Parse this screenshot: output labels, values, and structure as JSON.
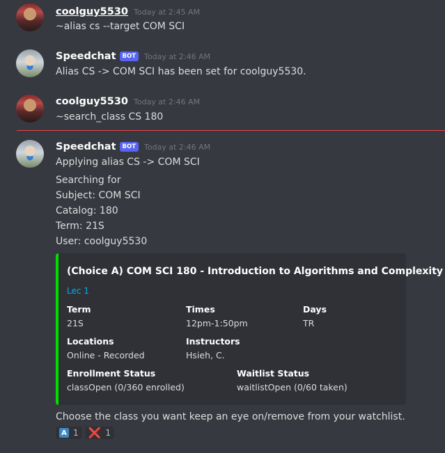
{
  "messages": [
    {
      "user": "coolguy5530",
      "time": "Today at 2:45 AM",
      "lines": [
        "~alias cs --target COM SCI"
      ]
    },
    {
      "user": "Speedchat",
      "bot": "BOT",
      "time": "Today at 2:46 AM",
      "lines": [
        "Alias CS -> COM SCI has been set for coolguy5530."
      ]
    },
    {
      "user": "coolguy5530",
      "time": "Today at 2:46 AM",
      "lines": [
        "~search_class CS 180"
      ]
    },
    {
      "user": "Speedchat",
      "bot": "BOT",
      "time": "Today at 2:46 AM",
      "lines": [
        "Applying alias CS -> COM SCI",
        "Searching for",
        "Subject: COM SCI",
        "Catalog: 180",
        "Term: 21S",
        "User: coolguy5530"
      ]
    }
  ],
  "embed": {
    "title": "(Choice A) COM SCI 180 - Introduction to Algorithms and Complexity",
    "link": "Lec 1",
    "accent": "#00e000",
    "fields": [
      {
        "name": "Term",
        "value": "21S"
      },
      {
        "name": "Times",
        "value": "12pm-1:50pm"
      },
      {
        "name": "Days",
        "value": "TR"
      },
      {
        "name": "Locations",
        "value": "Online - Recorded"
      },
      {
        "name": "Instructors",
        "value": "Hsieh, C."
      },
      {
        "name": "Enrollment Status",
        "value": "classOpen (0/360 enrolled)"
      },
      {
        "name": "Waitlist Status",
        "value": "waitlistOpen (0/60 taken)"
      }
    ]
  },
  "footer_text": "Choose the class you want keep an eye on/remove from your watchlist.",
  "reactions": [
    {
      "emoji": "A",
      "icon": "regional-a-icon",
      "count": "1"
    },
    {
      "emoji": "❌",
      "icon": "cross-mark-icon",
      "count": "1"
    }
  ],
  "colors": {
    "background": "#36393f",
    "bot_badge": "#5865f2",
    "new_divider": "#ed4245",
    "link": "#00aff4"
  }
}
